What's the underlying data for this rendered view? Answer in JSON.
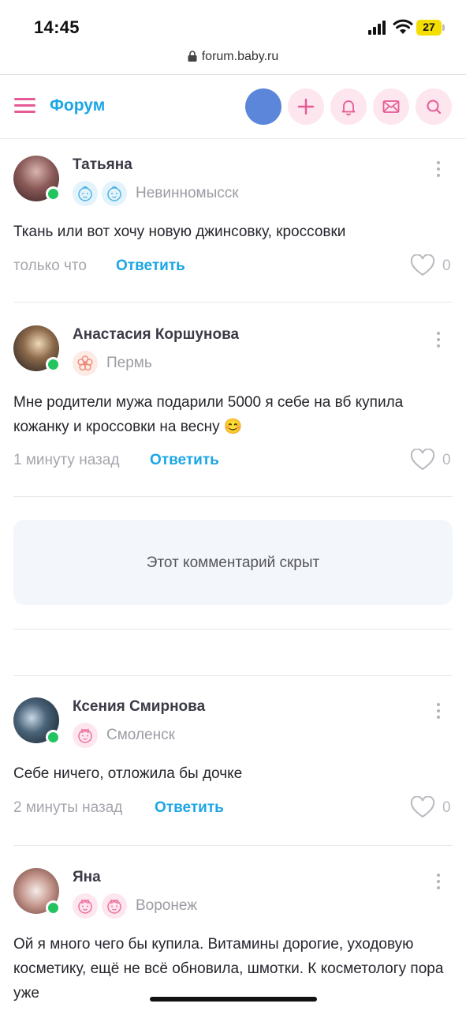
{
  "status_bar": {
    "time": "14:45",
    "battery": "27"
  },
  "url_bar": {
    "url": "forum.baby.ru"
  },
  "header": {
    "title": "Форум"
  },
  "comments": [
    {
      "author": "Татьяна",
      "city": "Невинномысск",
      "text": "Ткань или вот хочу новую джинсовку, кроссовки",
      "time": "только что",
      "reply_label": "Ответить",
      "likes": "0"
    },
    {
      "author": "Анастасия Коршунова",
      "city": "Пермь",
      "text": "Мне родители мужа подарили 5000 я себе на вб купила кожанку и кроссовки на весну 😊",
      "time": "1 минуту назад",
      "reply_label": "Ответить",
      "likes": "0"
    },
    {
      "author": "Ксения Смирнова",
      "city": "Смоленск",
      "text": "Себе ничего, отложила бы дочке",
      "time": "2 минуты назад",
      "reply_label": "Ответить",
      "likes": "0"
    },
    {
      "author": "Яна",
      "city": "Воронеж",
      "text": "Ой я много чего бы купила. Витамины дорогие, уходовую косметику, ещё не всё обновила, шмотки. К косметологу пора уже"
    }
  ],
  "hidden_comment": {
    "text": "Этот комментарий скрыт"
  },
  "colors": {
    "accent_blue": "#1ba6e6",
    "accent_pink": "#e65a95",
    "online": "#21c45f"
  },
  "icons": [
    "hamburger-menu-icon",
    "plus-icon",
    "bell-icon",
    "envelope-icon",
    "search-icon",
    "heart-icon",
    "kebab-icon",
    "baby-boy-badge-icon",
    "baby-girl-badge-icon",
    "flower-badge-icon"
  ]
}
